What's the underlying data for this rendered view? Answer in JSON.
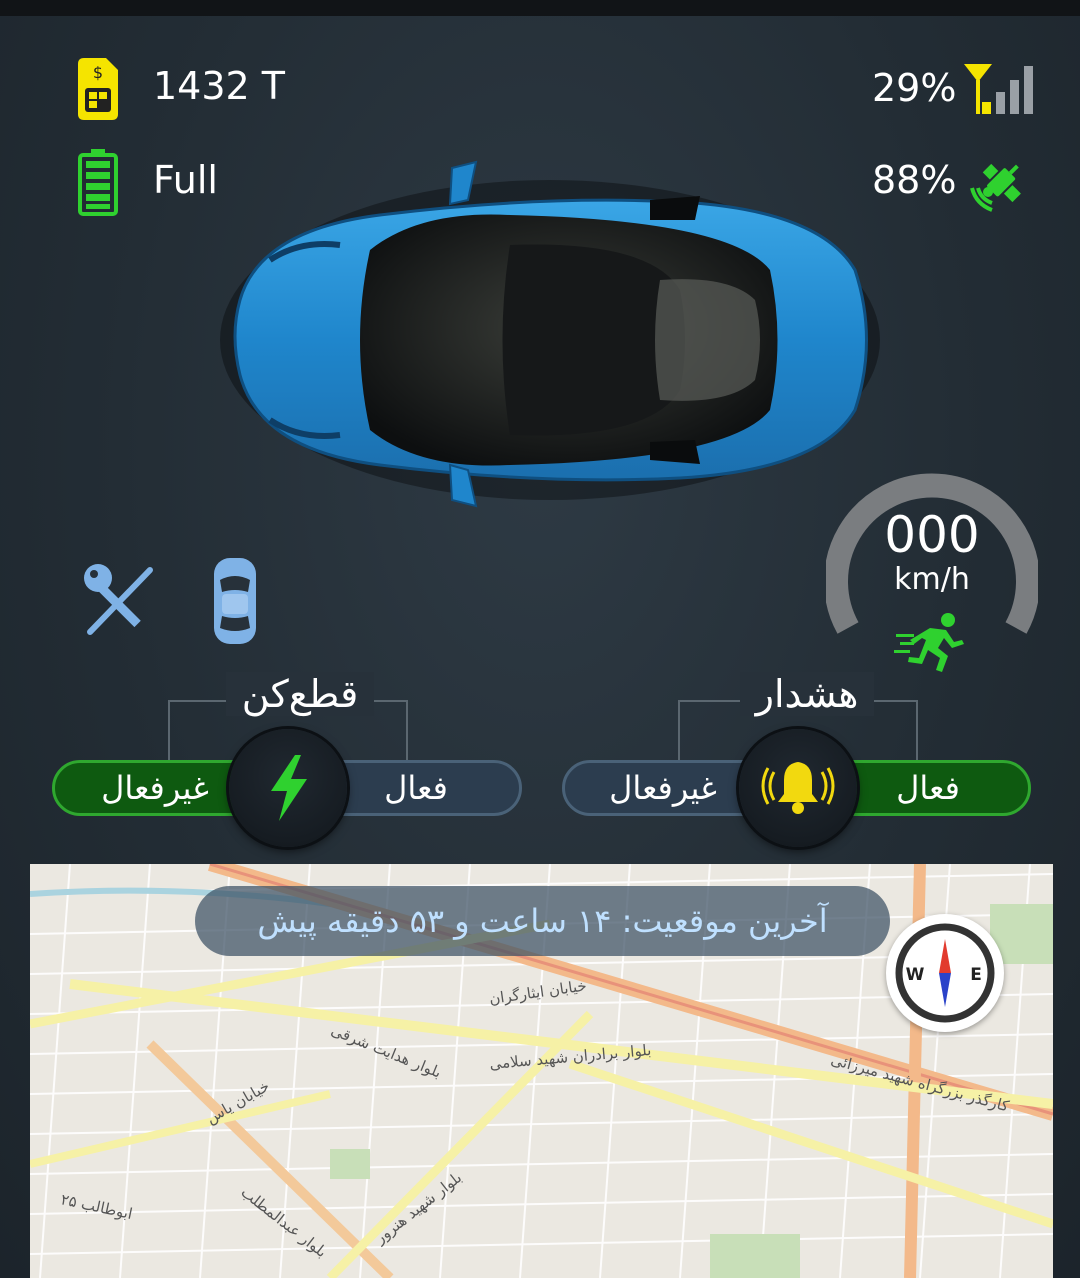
{
  "status": {
    "sim_credit": "1432 T",
    "battery": "Full",
    "signal": "29%",
    "gps": "88%"
  },
  "speed": {
    "value": "000",
    "unit": "km/h"
  },
  "cutoff": {
    "title": "قطع‌کن",
    "inactive_label": "غیرفعال",
    "active_label": "فعال"
  },
  "alarm": {
    "title": "هشدار",
    "inactive_label": "غیرفعال",
    "active_label": "فعال"
  },
  "map": {
    "last_location": "آخرین موقعیت: ۱۴ ساعت و ۵۳ دقیقه پیش",
    "compass_w": "W",
    "compass_e": "E",
    "street_labels": [
      "بلوار هدایت شرقی",
      "بلوار برادران شهید سلامی",
      "بلوار شهید هنرور",
      "بلوار عبدالمطلب",
      "کارگذر بزرگراه شهید میرزائی",
      "خیابان ایثارگران",
      "خیابان یاس",
      "ابوطالب ۲۵"
    ]
  },
  "colors": {
    "accent_green": "#2fd12f",
    "alarm_yellow": "#f2d90f",
    "sim_yellow": "#f5e400",
    "background": "#27313a"
  },
  "icons": [
    "sim-card-icon",
    "battery-icon",
    "signal-icon",
    "satellite-icon",
    "key-crossed-icon",
    "car-small-icon",
    "running-man-icon",
    "lightning-icon",
    "bell-icon",
    "compass-icon"
  ]
}
